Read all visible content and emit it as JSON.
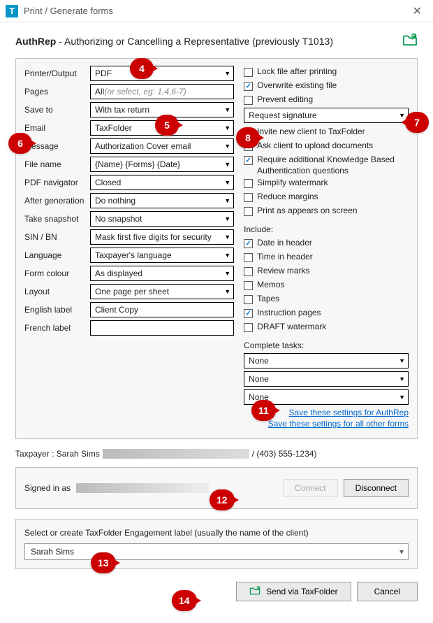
{
  "titlebar": {
    "app_letter": "T",
    "title": "Print / Generate forms"
  },
  "header": {
    "bold": "AuthRep",
    "rest": " - Authorizing or Cancelling a Representative (previously T1013)"
  },
  "left_fields": {
    "printer_output": {
      "label": "Printer/Output",
      "value": "PDF"
    },
    "pages": {
      "label": "Pages",
      "prefix": "All",
      "placeholder": " (or select, eg: 1,4,6-7)"
    },
    "save_to": {
      "label": "Save to",
      "value": "With tax return"
    },
    "email": {
      "label": "Email",
      "value": "TaxFolder"
    },
    "message": {
      "label": "Message",
      "value": "Authorization Cover email"
    },
    "file_name": {
      "label": "File name",
      "value": "{Name} {Forms} {Date}"
    },
    "pdf_navigator": {
      "label": "PDF navigator",
      "value": "Closed"
    },
    "after_generation": {
      "label": "After generation",
      "value": "Do nothing"
    },
    "take_snapshot": {
      "label": "Take snapshot",
      "value": "No snapshot"
    },
    "sin_bn": {
      "label": "SIN / BN",
      "value": "Mask first five digits for security"
    },
    "language": {
      "label": "Language",
      "value": "Taxpayer's language"
    },
    "form_colour": {
      "label": "Form colour",
      "value": "As displayed"
    },
    "layout": {
      "label": "Layout",
      "value": "One page per sheet"
    },
    "english_label": {
      "label": "English label",
      "value": "Client Copy"
    },
    "french_label": {
      "label": "French label",
      "value": ""
    }
  },
  "right_checks": {
    "lock_after": {
      "label": "Lock file after printing",
      "checked": false
    },
    "overwrite": {
      "label": "Overwrite existing file",
      "checked": true
    },
    "prevent_editing": {
      "label": "Prevent editing",
      "checked": false
    },
    "request_signature": {
      "value": "Request signature"
    },
    "invite_new": {
      "label": "Invite new client to TaxFolder",
      "checked": true
    },
    "ask_upload": {
      "label": "Ask client to upload documents",
      "checked": true
    },
    "require_kba": {
      "label": "Require additional Knowledge Based Authentication questions",
      "checked": true
    },
    "simplify": {
      "label": "Simplify watermark",
      "checked": false
    },
    "reduce_margins": {
      "label": "Reduce margins",
      "checked": false
    },
    "print_as_screen": {
      "label": "Print as appears on screen",
      "checked": false
    },
    "include_head": "Include:",
    "date_header": {
      "label": "Date in header",
      "checked": true
    },
    "time_header": {
      "label": "Time in header",
      "checked": false
    },
    "review_marks": {
      "label": "Review marks",
      "checked": false
    },
    "memos": {
      "label": "Memos",
      "checked": false
    },
    "tapes": {
      "label": "Tapes",
      "checked": false
    },
    "instruction": {
      "label": "Instruction pages",
      "checked": true
    },
    "draft_wm": {
      "label": "DRAFT watermark",
      "checked": false
    },
    "complete_head": "Complete tasks:",
    "task1": "None",
    "task2": "None",
    "task3": "None",
    "save_auth": "Save these settings for AuthRep",
    "save_all": "Save these settings for all other forms"
  },
  "taxpayer": {
    "prefix": "Taxpayer  :  Sarah Sims",
    "phone": " / (403) 555-1234)"
  },
  "signed": {
    "label": "Signed in as",
    "connect": "Connect",
    "disconnect": "Disconnect"
  },
  "engage": {
    "label": "Select or create TaxFolder Engagement label (usually the name of the client)",
    "value": "Sarah Sims"
  },
  "footer": {
    "send": "Send via TaxFolder",
    "cancel": "Cancel"
  },
  "callouts": {
    "c4": "4",
    "c5": "5",
    "c6": "6",
    "c7": "7",
    "c8": "8",
    "c11": "11",
    "c12": "12",
    "c13": "13",
    "c14": "14"
  }
}
